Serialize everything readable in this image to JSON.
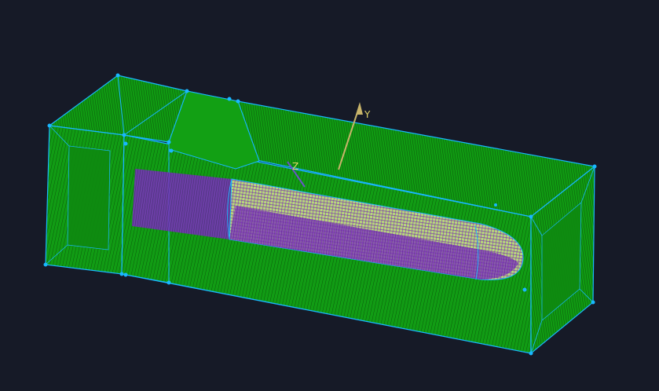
{
  "viewport": {
    "background": "#161a27",
    "mesh_fill": "#0fa012",
    "mesh_edge": "#19b7ff",
    "mesh_line": "#0a5a0a",
    "inner_mesh": "#8a2cc8",
    "inner_highlight": "#d9ef9a",
    "axis_color": "#c8b46a"
  },
  "axes": {
    "y_label": "Y",
    "z_label": "Z"
  }
}
